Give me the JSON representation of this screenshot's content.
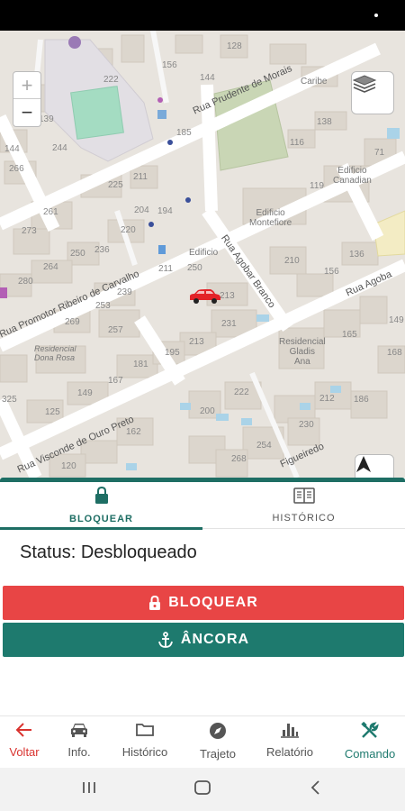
{
  "map": {
    "zoom_in": "+",
    "zoom_out": "−",
    "streets": {
      "prudente": "Rua Prudente de Morais",
      "promotor": "Rua Promotor Ribeiro de Carvalho",
      "agobar": "Rua Agobar Branco",
      "agobar_right": "Rua Agoba",
      "visconde": "Rua Visconde de Ouro Preto",
      "queiredo": "Figueiredo"
    },
    "places": {
      "caribe": "Caribe",
      "canadian": "Edificio\nCanadian",
      "montefiore": "Edificio\nMontefiore",
      "edificio": "Edificio",
      "gladis": "Residencial\nGladis\nAna",
      "dona_rosa": "Residencial\nDona Rosa"
    },
    "numbers": [
      "128",
      "156",
      "144",
      "222",
      "139",
      "244",
      "185",
      "116",
      "138",
      "71",
      "144",
      "266",
      "225",
      "211",
      "119",
      "261",
      "204",
      "194",
      "273",
      "220",
      "250",
      "236",
      "264",
      "250",
      "211",
      "210",
      "136",
      "280",
      "239",
      "253",
      "149",
      "257",
      "213",
      "231",
      "165",
      "269",
      "195",
      "181",
      "213",
      "167",
      "222",
      "212",
      "186",
      "149",
      "325",
      "230",
      "200",
      "125",
      "254",
      "162",
      "268",
      "120",
      "156",
      "139",
      "168"
    ]
  },
  "tabs": {
    "block_label": "BLOQUEAR",
    "history_label": "HISTÓRICO"
  },
  "status": {
    "text": "Status: Desbloqueado"
  },
  "actions": {
    "block_label": "BLOQUEAR",
    "anchor_label": "ÂNCORA"
  },
  "colors": {
    "teal": "#1e7a6e",
    "red": "#e84545",
    "back_red": "#d9332f"
  },
  "bottom_nav": {
    "back": "Voltar",
    "info": "Info.",
    "history": "Histórico",
    "route": "Trajeto",
    "report": "Relatório",
    "command": "Comando"
  }
}
